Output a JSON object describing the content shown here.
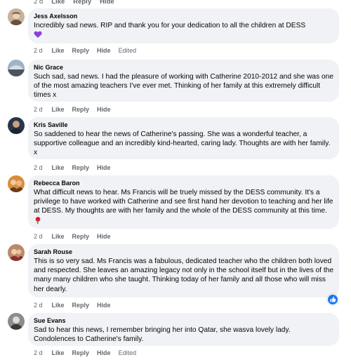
{
  "top_actions": {
    "time": "2 d",
    "like": "Like",
    "reply": "Reply",
    "hide": "Hide"
  },
  "comments": [
    {
      "name": "Jess Axelsson",
      "text": "Incredibly sad news. RIP and thank you for your dedication to all the children at DESS",
      "emoji": "purple-heart-icon",
      "time": "2 d",
      "like": "Like",
      "reply": "Reply",
      "hide": "Hide",
      "edited": "Edited"
    },
    {
      "name": "Nic Grace",
      "text": "Such sad, sad news. I had the pleasure of working with Catherine 2010-2012 and she was one of the most amazing teachers I've ever met. Thinking of her family at this extremely difficult times x",
      "time": "2 d",
      "like": "Like",
      "reply": "Reply",
      "hide": "Hide"
    },
    {
      "name": "Kris Saville",
      "text": "So saddened to hear the news of Catherine's passing. She was a wonderful teacher, a supportive colleague and an incredibly kind-hearted, caring lady. Thoughts are with her family. x",
      "time": "2 d",
      "like": "Like",
      "reply": "Reply",
      "hide": "Hide"
    },
    {
      "name": "Rebecca Baron",
      "text": "What difficult news to hear. Ms Francis will be truely missed by the DESS community. It's a privilege to have worked with Catherine and see first hand her devotion to teaching and her life at DESS. My thoughts are with her family and the whole of the DESS community at this time.",
      "emoji": "rose-icon",
      "time": "2 d",
      "like": "Like",
      "reply": "Reply",
      "hide": "Hide"
    },
    {
      "name": "Sarah Rouse",
      "text": "This is so very sad. Ms Francis was a fabulous, dedicated teacher who the children both loved and respected. She leaves an amazing legacy not only in the school itself but in the lives of the many many children who she taught. Thinking today of her family and all those who will miss her dearly.",
      "time": "2 d",
      "like": "Like",
      "reply": "Reply",
      "hide": "Hide"
    },
    {
      "name": "Sue Evans",
      "text": "Sad to hear this news, I remember bringing her into Qatar, she wasva lovely lady. Condolences to Catherine's family.",
      "time": "2 d",
      "like": "Like",
      "reply": "Reply",
      "hide": "Hide",
      "edited": "Edited"
    }
  ],
  "colors": {
    "bubble": "#f0f2f5",
    "meta": "#65676b",
    "like_badge": "#1877f2"
  }
}
